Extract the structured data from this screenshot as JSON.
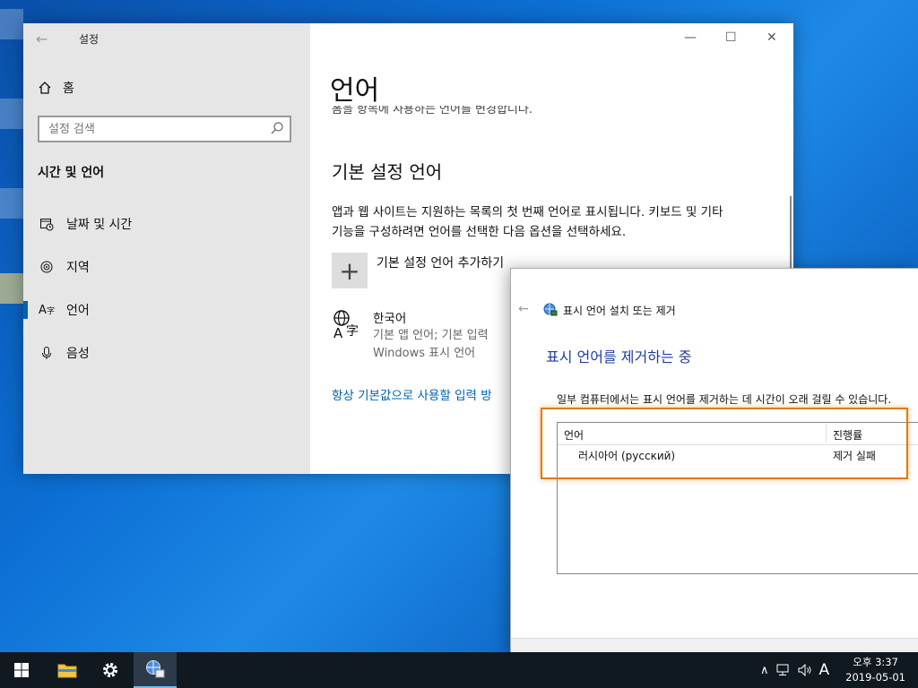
{
  "settings": {
    "window_title": "설정",
    "home_label": "홈",
    "search_placeholder": "설정 검색",
    "section_title": "시간 및 언어",
    "nav": [
      {
        "label": "날짜 및 시간",
        "icon": "calendar-clock-icon"
      },
      {
        "label": "지역",
        "icon": "globe-icon"
      },
      {
        "label": "언어",
        "icon": "language-icon"
      },
      {
        "label": "음성",
        "icon": "microphone-icon"
      }
    ],
    "page_title": "언어",
    "clipped_text": "폼을 항목에 사용하는 언어를 변경합니다.",
    "preferred_heading": "기본 설정 언어",
    "preferred_desc": "앱과 웹 사이트는 지원하는 목록의 첫 번째 언어로 표시됩니다. 키보드 및 기타 기능을 구성하려면 언어를 선택한 다음 옵션을 선택하세요.",
    "add_language_label": "기본 설정 언어 추가하기",
    "language": {
      "name": "한국어",
      "sub1": "기본 앱 언어; 기본 입력",
      "sub2": "Windows 표시 언어"
    },
    "link_text": "항상 기본값으로 사용할 입력 방"
  },
  "dialog": {
    "title": "표시 언어 설치 또는 제거",
    "heading": "표시 언어를 제거하는 중",
    "note": "일부 컴퓨터에서는 표시 언어를 제거하는 데 시간이 오래 걸릴 수 있습니다.",
    "columns": [
      "언어",
      "진행률"
    ],
    "rows": [
      {
        "language": "러시아어 (русский)",
        "status": "제거 실패"
      }
    ]
  },
  "taskbar": {
    "input_indicator": "A",
    "time": "오후 3:37",
    "date": "2019-05-01"
  }
}
